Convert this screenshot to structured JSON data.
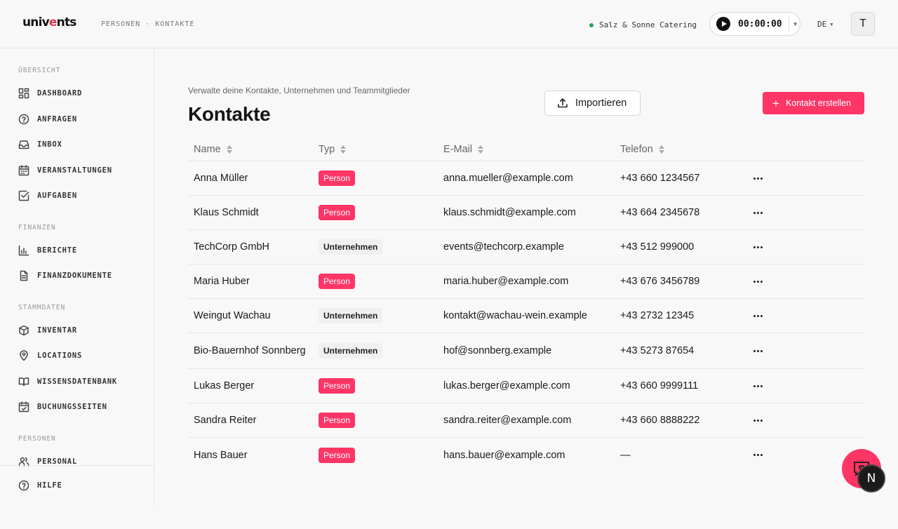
{
  "header": {
    "logo_prefix": "univ",
    "logo_accent": "e",
    "logo_suffix": "nts",
    "breadcrumb": "PERSONEN · KONTAKTE",
    "organization": "Salz & Sonne Catering",
    "organization_status_color": "#22a55b",
    "timer": "00:00:00",
    "language": "DE",
    "avatar_initial": "T"
  },
  "sidebar": {
    "sections": [
      {
        "title": "ÜBERSICHT",
        "items": [
          {
            "label": "DASHBOARD",
            "icon": "dashboard-icon"
          },
          {
            "label": "ANFRAGEN",
            "icon": "question-bubble-icon"
          },
          {
            "label": "INBOX",
            "icon": "inbox-icon"
          },
          {
            "label": "VERANSTALTUNGEN",
            "icon": "calendar-icon"
          },
          {
            "label": "AUFGABEN",
            "icon": "checkbox-icon"
          }
        ]
      },
      {
        "title": "FINANZEN",
        "items": [
          {
            "label": "BERICHTE",
            "icon": "bar-chart-icon"
          },
          {
            "label": "FINANZDOKUMENTE",
            "icon": "document-icon"
          }
        ]
      },
      {
        "title": "STAMMDATEN",
        "items": [
          {
            "label": "INVENTAR",
            "icon": "box-icon"
          },
          {
            "label": "LOCATIONS",
            "icon": "map-pin-icon"
          },
          {
            "label": "WISSENSDATENBANK",
            "icon": "book-icon"
          },
          {
            "label": "BUCHUNGSSEITEN",
            "icon": "calendar-check-icon"
          }
        ]
      },
      {
        "title": "PERSONEN",
        "items": [
          {
            "label": "PERSONAL",
            "icon": "users-icon"
          }
        ]
      }
    ],
    "help_label": "HILFE"
  },
  "main": {
    "subtitle": "Verwalte deine Kontakte, Unternehmen und Teammitglieder",
    "title": "Kontakte",
    "import_label": "Importieren",
    "create_label": "Kontakt erstellen",
    "accent_color": "#ff3566",
    "columns": [
      "Name",
      "Typ",
      "E-Mail",
      "Telefon"
    ],
    "rows": [
      {
        "name": "Anna Müller",
        "type": "Person",
        "kind": "person",
        "email": "anna.mueller@example.com",
        "phone": "+43 660 1234567"
      },
      {
        "name": "Klaus Schmidt",
        "type": "Person",
        "kind": "person",
        "email": "klaus.schmidt@example.com",
        "phone": "+43 664 2345678"
      },
      {
        "name": "TechCorp GmbH",
        "type": "Unternehmen",
        "kind": "company",
        "email": "events@techcorp.example",
        "phone": "+43 512 999000"
      },
      {
        "name": "Maria Huber",
        "type": "Person",
        "kind": "person",
        "email": "maria.huber@example.com",
        "phone": "+43 676 3456789"
      },
      {
        "name": "Weingut Wachau",
        "type": "Unternehmen",
        "kind": "company",
        "email": "kontakt@wachau-wein.example",
        "phone": "+43 2732 12345"
      },
      {
        "name": "Bio-Bauernhof Sonnberg",
        "type": "Unternehmen",
        "kind": "company",
        "email": "hof@sonnberg.example",
        "phone": "+43 5273 87654"
      },
      {
        "name": "Lukas Berger",
        "type": "Person",
        "kind": "person",
        "email": "lukas.berger@example.com",
        "phone": "+43 660 9999111"
      },
      {
        "name": "Sandra Reiter",
        "type": "Person",
        "kind": "person",
        "email": "sandra.reiter@example.com",
        "phone": "+43 660 8888222"
      },
      {
        "name": "Hans Bauer",
        "type": "Person",
        "kind": "person",
        "email": "hans.bauer@example.com",
        "phone": "—"
      }
    ]
  },
  "floating": {
    "chat_icon": "chat-heart-icon",
    "badge_letter": "N"
  }
}
